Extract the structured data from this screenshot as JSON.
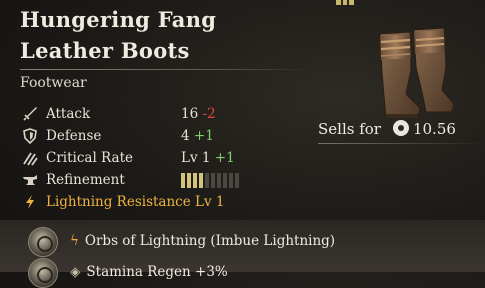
{
  "item": {
    "name_line1": "Hungering Fang",
    "name_line2": "Leather Boots",
    "category": "Footwear"
  },
  "stats": [
    {
      "label": "Attack",
      "value": "16",
      "delta": "-2",
      "delta_type": "neg",
      "icon": "sword-icon"
    },
    {
      "label": "Defense",
      "value": "4",
      "delta": "+1",
      "delta_type": "pos",
      "icon": "shield-icon"
    },
    {
      "label": "Critical Rate",
      "value": "Lv 1",
      "delta": "+1",
      "delta_type": "pos",
      "icon": "claw-icon"
    },
    {
      "label": "Refinement",
      "value": "",
      "delta": "",
      "delta_type": "",
      "icon": "anvil-icon"
    }
  ],
  "refinement": {
    "filled": 4,
    "total": 10
  },
  "lightning_resistance": {
    "label": "Lightning Resistance Lv 1",
    "icon": "lightning-bolt-icon"
  },
  "sells": {
    "label": "Sells for",
    "value": "10.56",
    "icon": "coin-icon"
  },
  "effects": [
    {
      "label": "Orbs of Lightning (Imbue Lightning)",
      "icon": "lightning-bolt-icon"
    },
    {
      "label": "Stamina Regen +3%",
      "icon": "stamina-icon"
    }
  ],
  "colors": {
    "negative": "#e3463e",
    "positive": "#7ed16a",
    "lightning": "#f0b43e",
    "refine_on": "#d4c57a"
  }
}
